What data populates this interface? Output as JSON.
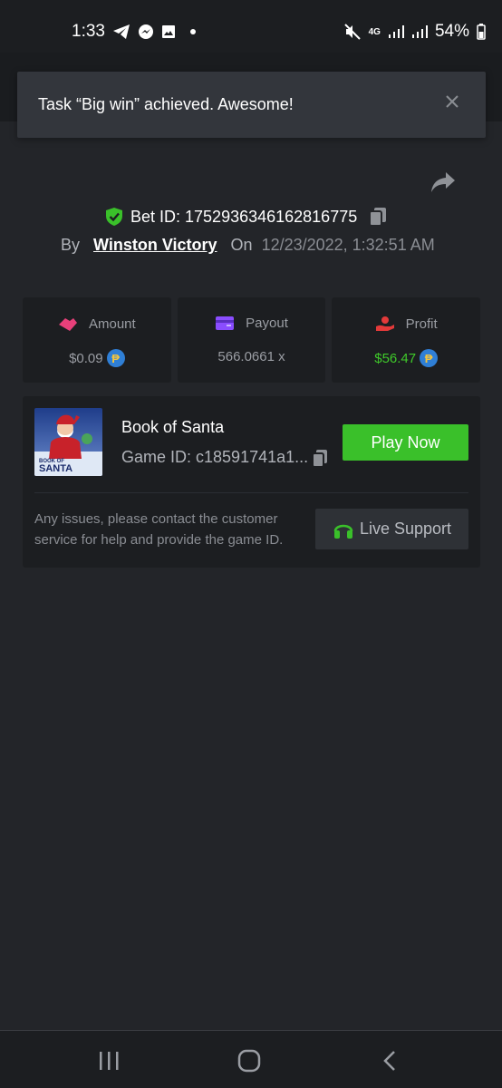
{
  "status_bar": {
    "time": "1:33",
    "battery": "54%",
    "network": "4G",
    "icons": [
      "telegram-icon",
      "messenger-icon",
      "gallery-icon",
      "mute-icon",
      "signal-icon",
      "battery-icon"
    ]
  },
  "toast": {
    "message": "Task “Big win” achieved. Awesome!"
  },
  "bet": {
    "id_text": "Bet ID: 1752936346162816775",
    "by_label": "By",
    "author": "Winston Victory",
    "on_label": "On",
    "date": "12/23/2022, 1:32:51 AM"
  },
  "stats": {
    "amount": {
      "label": "Amount",
      "value": "$0.09",
      "color": "#e8407a"
    },
    "payout": {
      "label": "Payout",
      "value": "566.0661 x",
      "color": "#8a4dff"
    },
    "profit": {
      "label": "Profit",
      "value": "$56.47",
      "color": "#e33a3a",
      "value_color": "#3fc92a"
    },
    "coin_symbol": "₱"
  },
  "game": {
    "title": "Book of Santa",
    "game_id": "Game ID: c18591741a1...",
    "play_label": "Play Now",
    "thumb_text_1": "BOOK OF",
    "thumb_text_2": "SANTA",
    "help_text": "Any issues, please contact the customer service for help and provide the game ID.",
    "support_label": "Live Support",
    "accent": "#3ac02a"
  }
}
